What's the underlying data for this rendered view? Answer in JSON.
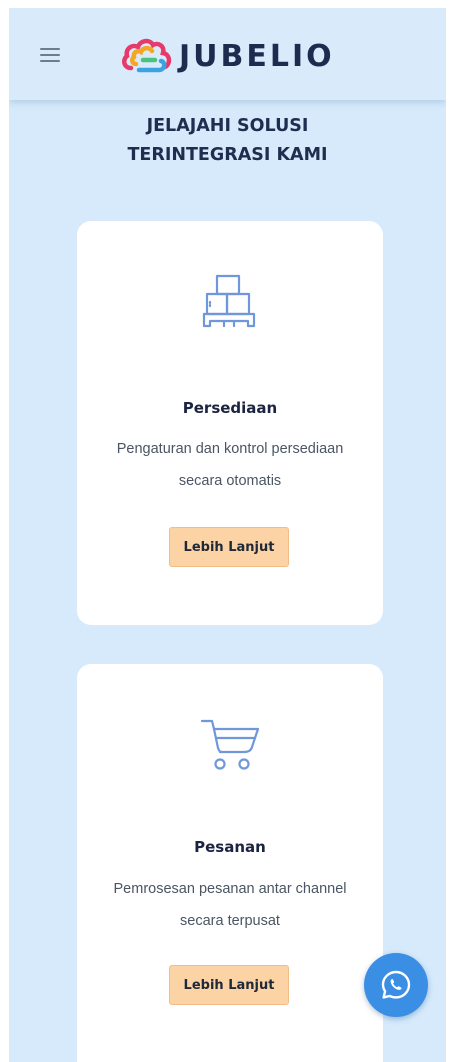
{
  "header": {
    "brand": "JUBELIO",
    "menu_icon": "hamburger-menu-icon",
    "logo_icon": "cloud-logo-icon"
  },
  "section": {
    "title_line1": "JELAJAHI SOLUSI",
    "title_line2": "TERINTEGRASI KAMI"
  },
  "cards": [
    {
      "icon": "inventory-boxes-icon",
      "title": "Persediaan",
      "desc_line1": "Pengaturan dan kontrol persediaan",
      "desc_line2": "secara otomatis",
      "button": "Lebih Lanjut"
    },
    {
      "icon": "shopping-cart-icon",
      "title": "Pesanan",
      "desc_line1": "Pemrosesan pesanan antar channel",
      "desc_line2": "secara terpusat",
      "button": "Lebih Lanjut"
    }
  ],
  "fab": {
    "icon": "whatsapp-icon"
  },
  "colors": {
    "background": "#d6eafc",
    "brand_text": "#1d2b4f",
    "button": "#fbd3a5",
    "icon_stroke": "#6f97d9",
    "fab": "#3a8ee3"
  }
}
